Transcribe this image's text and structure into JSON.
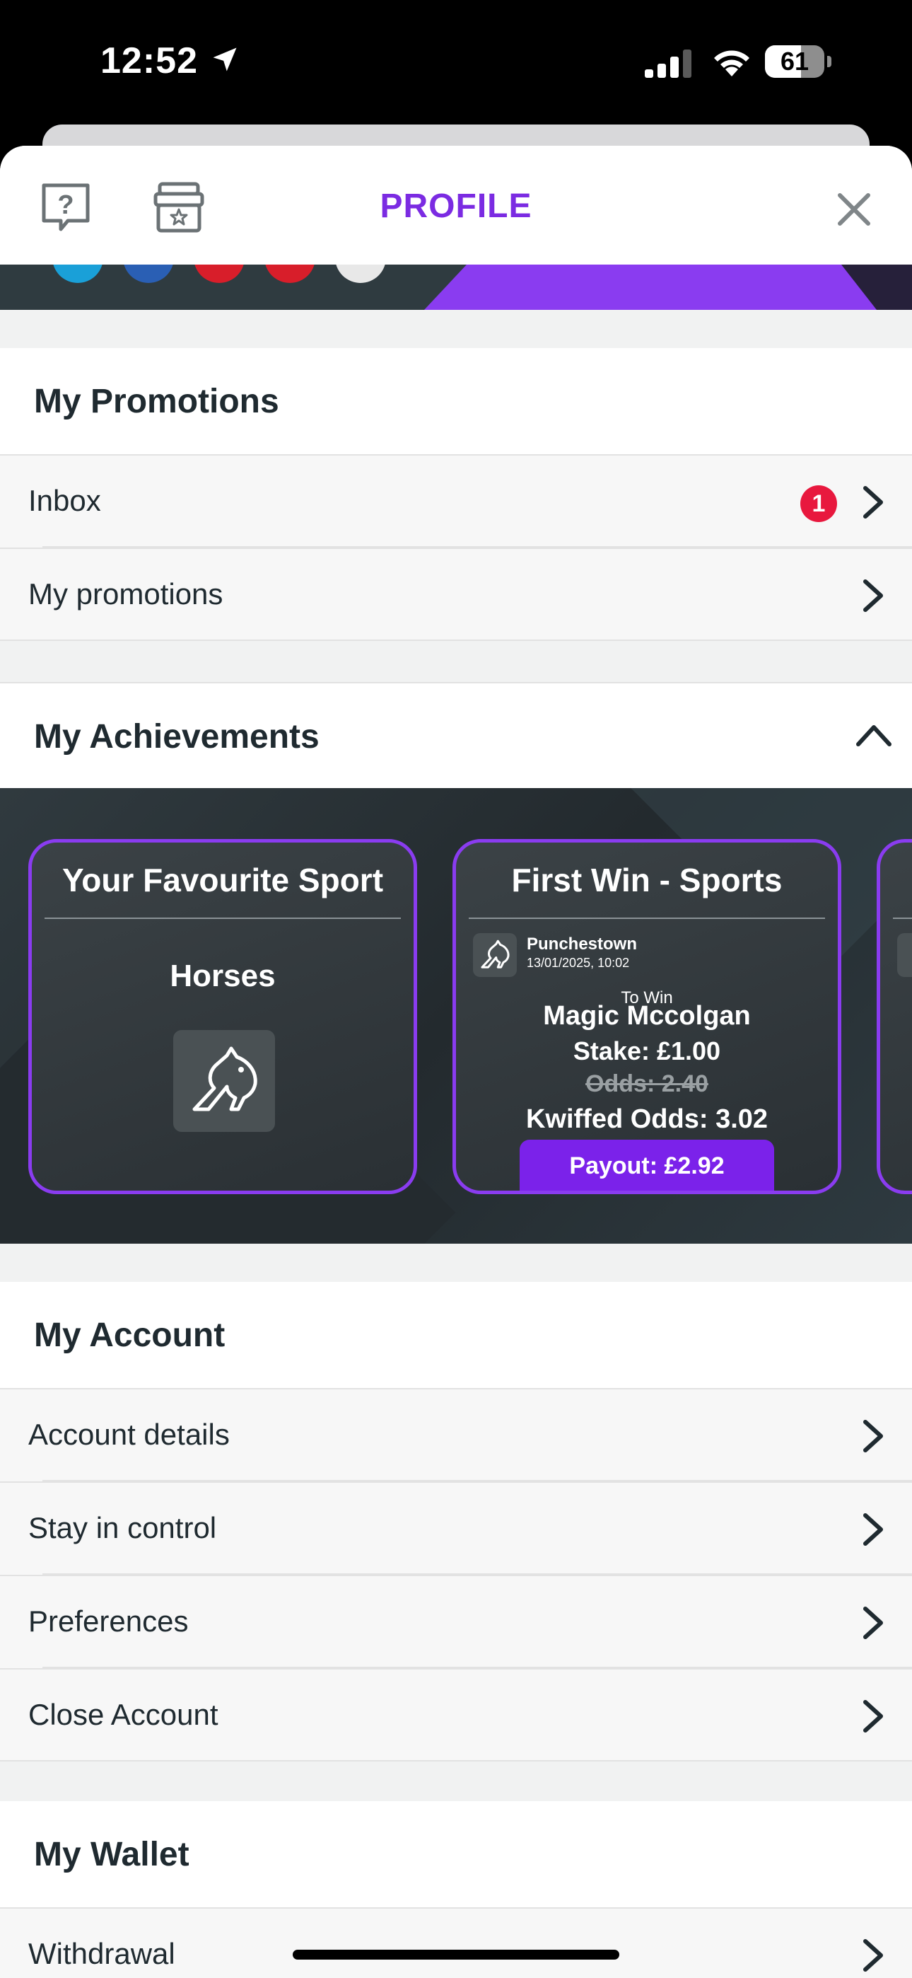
{
  "status_bar": {
    "time": "12:52",
    "battery": "61",
    "battery_fraction": 0.61
  },
  "header": {
    "title": "PROFILE"
  },
  "promotions": {
    "title": "My Promotions",
    "items": [
      {
        "label": "Inbox",
        "badge": "1"
      },
      {
        "label": "My promotions"
      }
    ]
  },
  "achievements": {
    "title": "My Achievements",
    "cards": [
      {
        "title": "Your Favourite Sport",
        "subtitle": "Horses"
      },
      {
        "title": "First Win - Sports",
        "race": "Punchestown",
        "date": "13/01/2025, 10:02",
        "market": "To Win",
        "selection": "Magic Mccolgan",
        "stake": "Stake: £1.00",
        "odds": "Odds: 2.40",
        "kwiffed_odds": "Kwiffed Odds: 3.02",
        "payout": "Payout: £2.92"
      }
    ]
  },
  "account": {
    "title": "My Account",
    "items": [
      {
        "label": "Account details"
      },
      {
        "label": "Stay in control"
      },
      {
        "label": "Preferences"
      },
      {
        "label": "Close Account"
      }
    ]
  },
  "wallet": {
    "title": "My Wallet",
    "items": [
      {
        "label": "Withdrawal"
      }
    ]
  },
  "colors": {
    "accent": "#7b2be2",
    "badge": "#e8183e",
    "card_border": "#8a3cf0"
  },
  "icons": [
    "location-arrow-icon",
    "signal-icon",
    "wifi-icon",
    "battery-icon",
    "help-icon",
    "store-icon",
    "close-icon",
    "chevron-right-icon",
    "chevron-up-icon",
    "horse-icon"
  ]
}
